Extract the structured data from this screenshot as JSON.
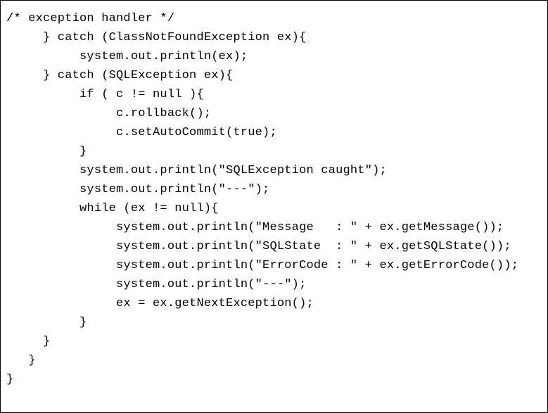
{
  "code": {
    "l1": "/* exception handler */",
    "l2": "     } catch (ClassNotFoundException ex){",
    "l3": "          system.out.println(ex);",
    "l4": "     } catch (SQLException ex){",
    "l5": "          if ( c != null ){",
    "l6": "               c.rollback();",
    "l7": "               c.setAutoCommit(true);",
    "l8": "          }",
    "l9": "          system.out.println(\"SQLException caught\");",
    "l10": "          system.out.println(\"---\");",
    "l11": "          while (ex != null){",
    "l12": "               system.out.println(\"Message   : \" + ex.getMessage());",
    "l13": "               system.out.println(\"SQLState  : \" + ex.getSQLState());",
    "l14": "               system.out.println(\"ErrorCode : \" + ex.getErrorCode());",
    "l15": "               system.out.println(\"---\");",
    "l16": "               ex = ex.getNextException();",
    "l17": "          }",
    "l18": "     }",
    "l19": "   }",
    "l20": "}"
  }
}
